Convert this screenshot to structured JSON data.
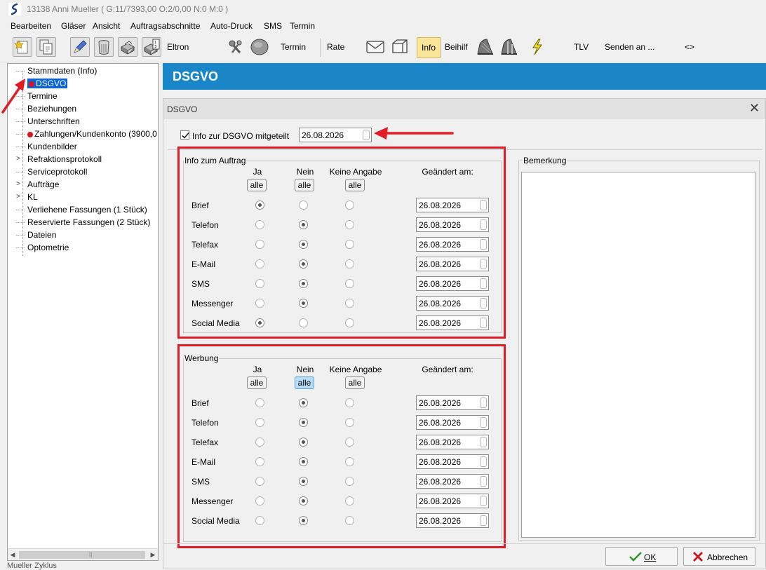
{
  "window": {
    "title": "13138  Anni Mueller (  G:11/7393,00   O:2/0,00 N:0 M:0 )"
  },
  "menu": [
    "Bearbeiten",
    "Gläser",
    "Ansicht",
    "Auftragsabschnitte",
    "Auto-Druck",
    "SMS",
    "Termin"
  ],
  "toolbar": {
    "eltron_label": "Eltron",
    "termin_label": "Termin",
    "rate_label": "Rate",
    "info_label": "Info",
    "beihilf_label": "Beihilf",
    "tlv_label": "TLV",
    "senden_label": "Senden an ...",
    "nav_label": "<>"
  },
  "tree": {
    "items": [
      {
        "label": "Stammdaten (Info)"
      },
      {
        "label": "DSGVO",
        "selected": true,
        "dot": true
      },
      {
        "label": "Termine"
      },
      {
        "label": "Beziehungen"
      },
      {
        "label": "Unterschriften"
      },
      {
        "label": "Zahlungen/Kundenkonto (3900,0",
        "dot": true
      },
      {
        "label": "Kundenbilder"
      },
      {
        "label": "Refraktionsprotokoll",
        "expandable": true
      },
      {
        "label": "Serviceprotokoll"
      },
      {
        "label": "Aufträge",
        "expandable": true
      },
      {
        "label": "KL",
        "expandable": true
      },
      {
        "label": "Verliehene Fassungen (1 Stück)"
      },
      {
        "label": "Reservierte Fassungen (2 Stück)"
      },
      {
        "label": "Dateien"
      },
      {
        "label": "Optometrie"
      }
    ],
    "below_label": "Mueller Zyklus"
  },
  "header": {
    "title": "DSGVO"
  },
  "dialog": {
    "title": "DSGVO",
    "close_glyph": "✕",
    "info_checkbox": {
      "label": "Info zur DSGVO mitgeteilt",
      "checked": true,
      "date": "26.08.2026"
    },
    "columns": {
      "ja": "Ja",
      "nein": "Nein",
      "keine": "Keine Angabe",
      "geaendert": "Geändert am:",
      "alle": "alle"
    },
    "auftrag": {
      "legend": "Info zum Auftrag",
      "rows": [
        {
          "label": "Brief",
          "choice": 0,
          "date": "26.08.2026"
        },
        {
          "label": "Telefon",
          "choice": 1,
          "date": "26.08.2026"
        },
        {
          "label": "Telefax",
          "choice": 1,
          "date": "26.08.2026"
        },
        {
          "label": "E-Mail",
          "choice": 1,
          "date": "26.08.2026"
        },
        {
          "label": "SMS",
          "choice": 1,
          "date": "26.08.2026"
        },
        {
          "label": "Messenger",
          "choice": 1,
          "date": "26.08.2026"
        },
        {
          "label": "Social Media",
          "choice": 0,
          "date": "26.08.2026"
        }
      ]
    },
    "werbung": {
      "legend": "Werbung",
      "rows": [
        {
          "label": "Brief",
          "choice": 1,
          "date": "26.08.2026"
        },
        {
          "label": "Telefon",
          "choice": 1,
          "date": "26.08.2026"
        },
        {
          "label": "Telefax",
          "choice": 1,
          "date": "26.08.2026"
        },
        {
          "label": "E-Mail",
          "choice": 1,
          "date": "26.08.2026"
        },
        {
          "label": "SMS",
          "choice": 1,
          "date": "26.08.2026"
        },
        {
          "label": "Messenger",
          "choice": 1,
          "date": "26.08.2026"
        },
        {
          "label": "Social Media",
          "choice": 1,
          "date": "26.08.2026"
        }
      ]
    },
    "bemerkung": {
      "legend": "Bemerkung",
      "text": ""
    },
    "buttons": {
      "ok": "OK",
      "abbrechen": "Abbrechen"
    }
  },
  "colors": {
    "accent_blue": "#1a86c8",
    "annotation_red": "#e11c24",
    "selection_blue": "#0a64d8"
  }
}
